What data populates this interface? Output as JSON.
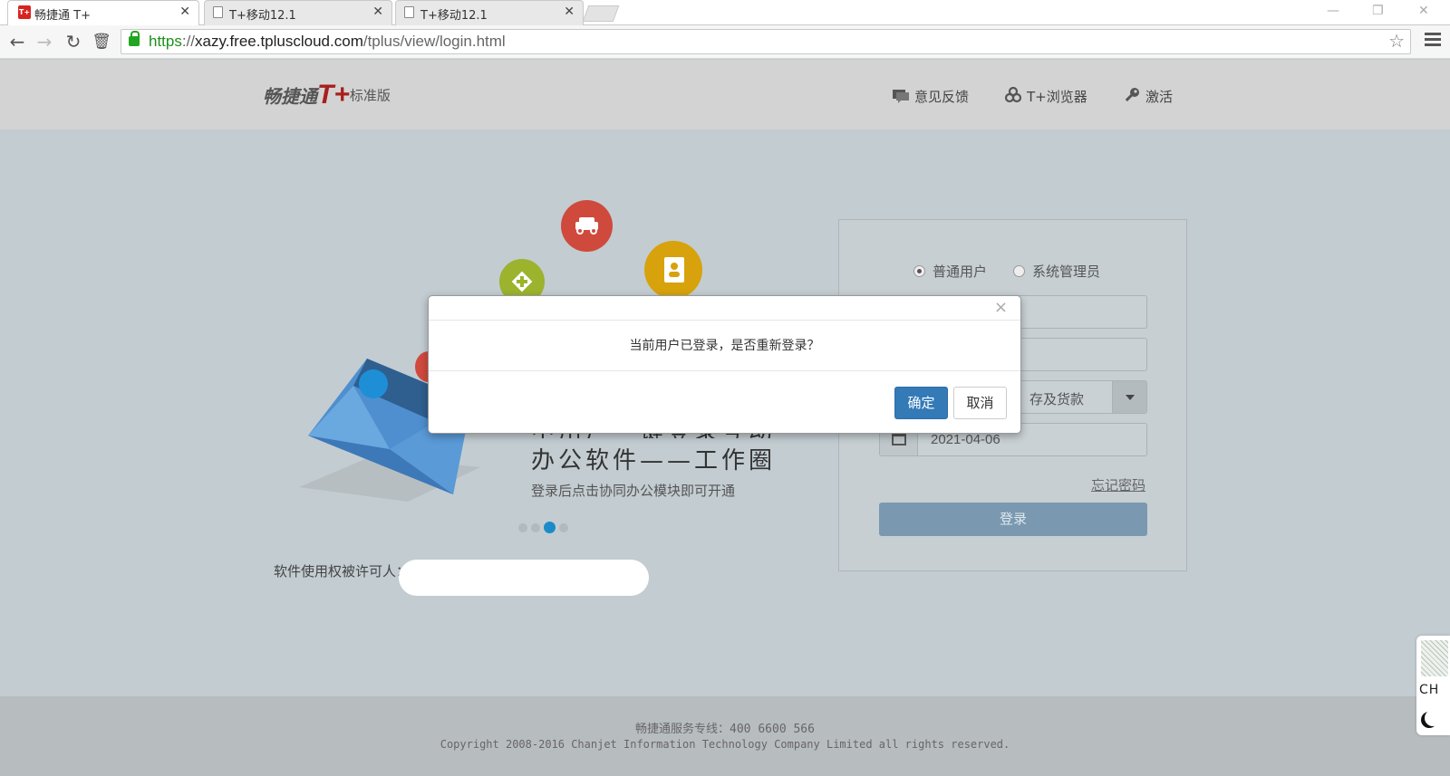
{
  "browser": {
    "tabs": [
      {
        "title": "畅捷通 T+",
        "active": true,
        "favicon": "T+"
      },
      {
        "title": "T+移动12.1",
        "active": false
      },
      {
        "title": "T+移动12.1",
        "active": false
      }
    ],
    "url": {
      "scheme": "https",
      "separator": "://",
      "host": "xazy.free.tpluscloud.com",
      "path": "/tplus/view/login.html"
    }
  },
  "header": {
    "logo": {
      "brand": "畅捷通",
      "tplus": "T+",
      "edition": "标准版"
    },
    "links": [
      {
        "label": "意见反馈",
        "icon": "feedback-icon"
      },
      {
        "label": "T+浏览器",
        "icon": "browser-icon"
      },
      {
        "label": "激活",
        "icon": "key-icon"
      }
    ]
  },
  "carousel": {
    "line1": "中用户—键登录互动",
    "line2": "办公软件——工作圈",
    "sub": "登录后点击协同办公模块即可开通",
    "dots": 4,
    "active_dot": 3
  },
  "license": {
    "label": "软件使用权被许可人："
  },
  "login": {
    "roles": [
      {
        "label": "普通用户",
        "checked": true
      },
      {
        "label": "系统管理员",
        "checked": false
      }
    ],
    "account_set_partial": "、存及货款",
    "date": "2021-04-06",
    "forgot": "忘记密码",
    "submit": "登录"
  },
  "footer": {
    "hotline": "畅捷通服务专线：400 6600 566",
    "copyright": "Copyright 2008-2016 Chanjet Information Technology Company Limited all rights reserved."
  },
  "side_widget": {
    "lang": "CH"
  },
  "modal": {
    "close": "×",
    "message": "当前用户已登录，是否重新登录？",
    "ok": "确定",
    "cancel": "取消"
  },
  "colors": {
    "primary": "#337ab7",
    "tplus_red": "#a81f1c",
    "login_button": "#7a99b0"
  }
}
